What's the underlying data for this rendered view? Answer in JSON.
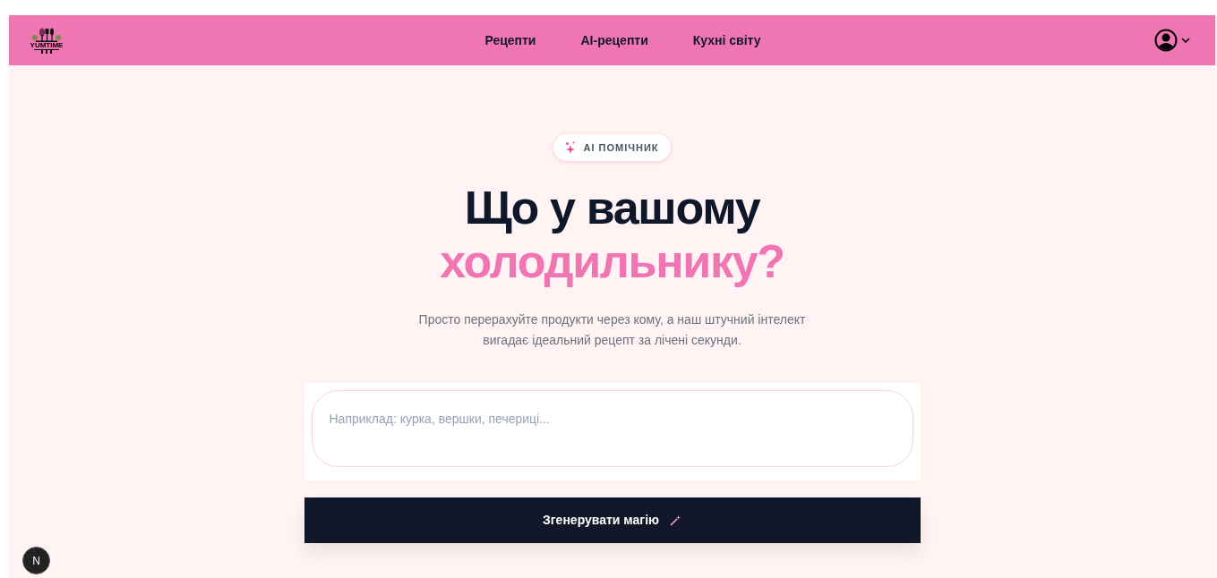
{
  "navbar": {
    "logo_text": "YUMTIME",
    "links": [
      {
        "label": "Рецепти"
      },
      {
        "label": "AI-рецепти"
      },
      {
        "label": "Кухні світу"
      }
    ]
  },
  "hero": {
    "badge": "AI ПОМІЧНИК",
    "title_line1": "Що у вашому",
    "title_line2": "холодильнику?",
    "subtitle_line1": "Просто перерахуйте продукти через кому, а наш штучний інтелект",
    "subtitle_line2": "вигадає ідеальний рецепт за лічені секунди."
  },
  "ingredients_field": {
    "placeholder": "Наприклад: курка, вершки, печериці..."
  },
  "generate_button": {
    "label": "Згенерувати магію"
  },
  "dev_badge": {
    "label": "N"
  }
}
